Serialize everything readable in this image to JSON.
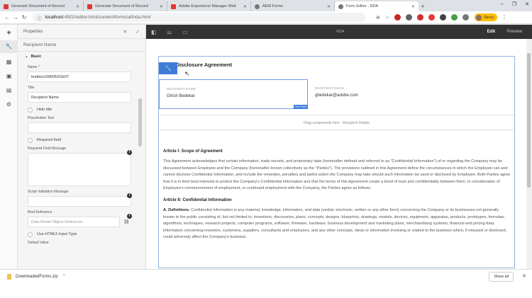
{
  "browser": {
    "tabs": [
      {
        "label": "Generate Document of Record"
      },
      {
        "label": "Generate Document of Record"
      },
      {
        "label": "Adobe Experience Manager Web"
      },
      {
        "label": "AEM Forms"
      },
      {
        "label": "Form Editor - NDA"
      }
    ],
    "url_host": "localhost",
    "url_path": ":4502/editor.html/content/forms/af/nda.html"
  },
  "props": {
    "header": "Properties",
    "component": "Recipient Name",
    "section": "Basic",
    "name_label": "Name *",
    "name_value": "textbox1996052GE07",
    "title_label": "Title",
    "title_value": "Recipient Name",
    "hide_title": "Hide title",
    "placeholder_label": "Placeholder Text",
    "required_label": "Required field",
    "required_msg_label": "Required Field Message",
    "script_msg_label": "Script Validation Message",
    "bind_label": "Bind Reference",
    "bind_placeholder": "Data Model Object Reference",
    "html5_label": "Use HTML5 Input Type",
    "default_label": "Default Value"
  },
  "canvas": {
    "title": "NDA",
    "edit": "Edit",
    "preview": "Preview",
    "form_title": "Non Disclosure Agreement",
    "recipient_name_label": "RECIPIENT NAME",
    "recipient_name_value": "Girish Bedekar",
    "recipient_email_label": "RECIPIENT EMAIL",
    "recipient_email_value": "gbedekar@adobe.com",
    "badge": "Text Field",
    "drop_text": "Drag components here - Recipient Details",
    "article1_title": "Article I: Scope of Agreement",
    "article1_text": "This Agreement acknowledges that certain information, trade secrets, and proprietary data (hereinafter defined and referred to as \"Confidential Information\") of or regarding the Company may be discussed between Employee and the Company (hereinafter known collectively as the \"Parties\"). The provisions outlined in this Agreement define the circumstances in which the Employee can and cannot disclose Confidential Information, and include the remedies, penalties and lawful action the Company may take should such information be used or disclosed by Employee. Both Parties agree that it is in their best interests to protect the Company's Confidential Information and that the terms of this Agreement create a bond of trust and confidentiality between them. In consideration of Employee's commencement of employment, or continued employment with the Company, the Parties agree as follows:",
    "article2_title": "Article II: Confidential Information",
    "article2_lead": "A. Definitions.",
    "article2_text": "Confidential Information is any material, knowledge, information, and data (verbal, electronic, written or any other form) concerning the Company or its businesses not generally known to the public consisting of, but not limited to, inventions, discoveries, plans, concepts, designs, blueprints, drawings, models, devices, equipment, apparatus, products, prototypes, formulae, algorithms, techniques, research projects, computer programs, software, firmware, hardware, business development and marketing plans, merchandising systems, financial and pricing data, information concerning investors, customers, suppliers, consultants and employees, and any other concepts, ideas or information involving or related to the business which, if misused or disclosed, could adversely affect the Company's business."
  },
  "downloads": {
    "file": "DownloadedForms.zip",
    "show_all": "Show all"
  }
}
